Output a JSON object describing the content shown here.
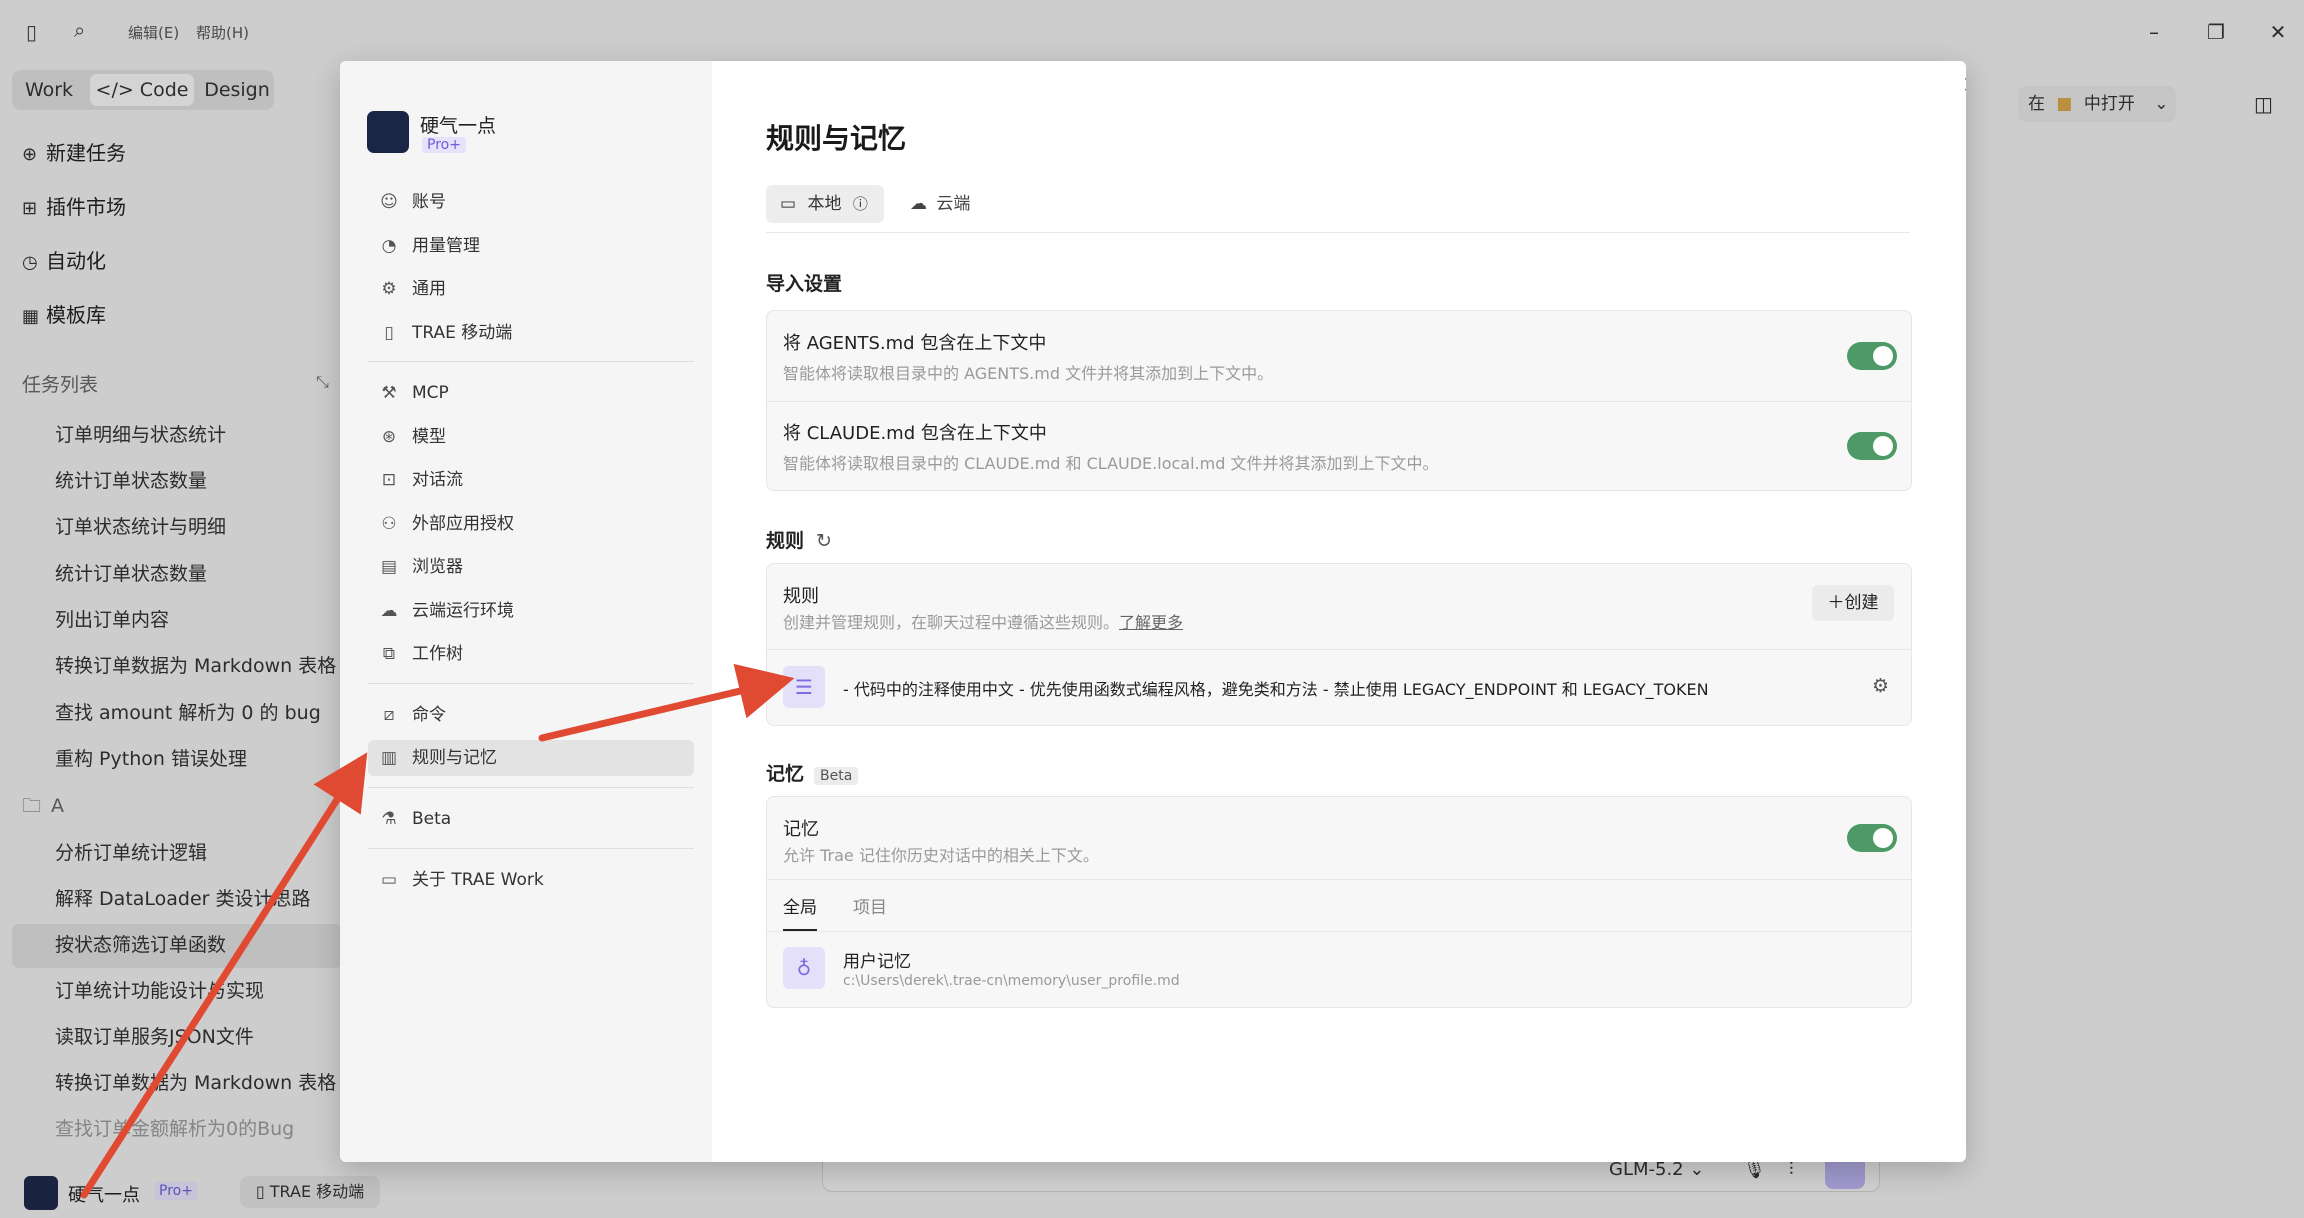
{
  "menubar": {
    "edit": "编辑(E)",
    "help": "帮助(H)"
  },
  "modes": {
    "work": "Work",
    "code": "</> Code",
    "design": "Design"
  },
  "nav": [
    "新建任务",
    "插件市场",
    "自动化",
    "模板库"
  ],
  "task_list_label": "任务列表",
  "tasks": [
    "订单明细与状态统计",
    "统计订单状态数量",
    "订单状态统计与明细",
    "统计订单状态数量",
    "列出订单内容",
    "转换订单数据为 Markdown 表格",
    "查找 amount 解析为 0 的 bug",
    "重构 Python 错误处理"
  ],
  "folder_label": "A",
  "folder_tasks": [
    "分析订单统计逻辑",
    "解释 DataLoader 类设计思路",
    "按状态筛选订单函数",
    "订单统计功能设计与实现",
    "读取订单服务JSON文件",
    "转换订单数据为 Markdown 表格",
    "查找订单金额解析为0的Bug"
  ],
  "bottom_user": {
    "name": "硬气一点",
    "badge": "Pro+",
    "mobile": "TRAE 移动端"
  },
  "bg_right": {
    "open_in": "在",
    "open_label": "中打开",
    "model": "GLM-5.2"
  },
  "profile": {
    "name": "硬气一点",
    "badge": "Pro+"
  },
  "settings_menu": {
    "group1": [
      "账号",
      "用量管理",
      "通用",
      "TRAE 移动端"
    ],
    "group2": [
      "MCP",
      "模型",
      "对话流",
      "外部应用授权",
      "浏览器",
      "云端运行环境",
      "工作树"
    ],
    "group3": [
      "命令",
      "规则与记忆"
    ],
    "group4": [
      "Beta"
    ],
    "group5": [
      "关于 TRAE Work"
    ]
  },
  "page": {
    "title": "规则与记忆",
    "tabs": [
      "本地",
      "云端"
    ],
    "import_title": "导入设置",
    "agents_title": "将 AGENTS.md 包含在上下文中",
    "agents_desc": "智能体将读取根目录中的 AGENTS.md 文件并将其添加到上下文中。",
    "claude_title": "将 CLAUDE.md 包含在上下文中",
    "claude_desc": "智能体将读取根目录中的 CLAUDE.md 和 CLAUDE.local.md 文件并将其添加到上下文中。",
    "rules_section": "规则",
    "rules_card_title": "规则",
    "rules_card_desc": "创建并管理规则，在聊天过程中遵循这些规则。",
    "learn_more": "了解更多",
    "create_button": "创建",
    "rule_text": "- 代码中的注释使用中文 - 优先使用函数式编程风格，避免类和方法 - 禁止使用 LEGACY_ENDPOINT 和 LEGACY_TOKEN",
    "memory_section": "记忆",
    "memory_badge": "Beta",
    "memory_title": "记忆",
    "memory_desc": "允许 Trae 记住你历史对话中的相关上下文。",
    "memory_tabs": [
      "全局",
      "项目"
    ],
    "user_memory_title": "用户记忆",
    "user_memory_path": "c:\\Users\\derek\\.trae-cn\\memory\\user_profile.md"
  },
  "colors": {
    "toggle_on": "#4e9a67",
    "annotation_arrow": "#e04a32",
    "pro_badge": "#6b5fd6"
  }
}
